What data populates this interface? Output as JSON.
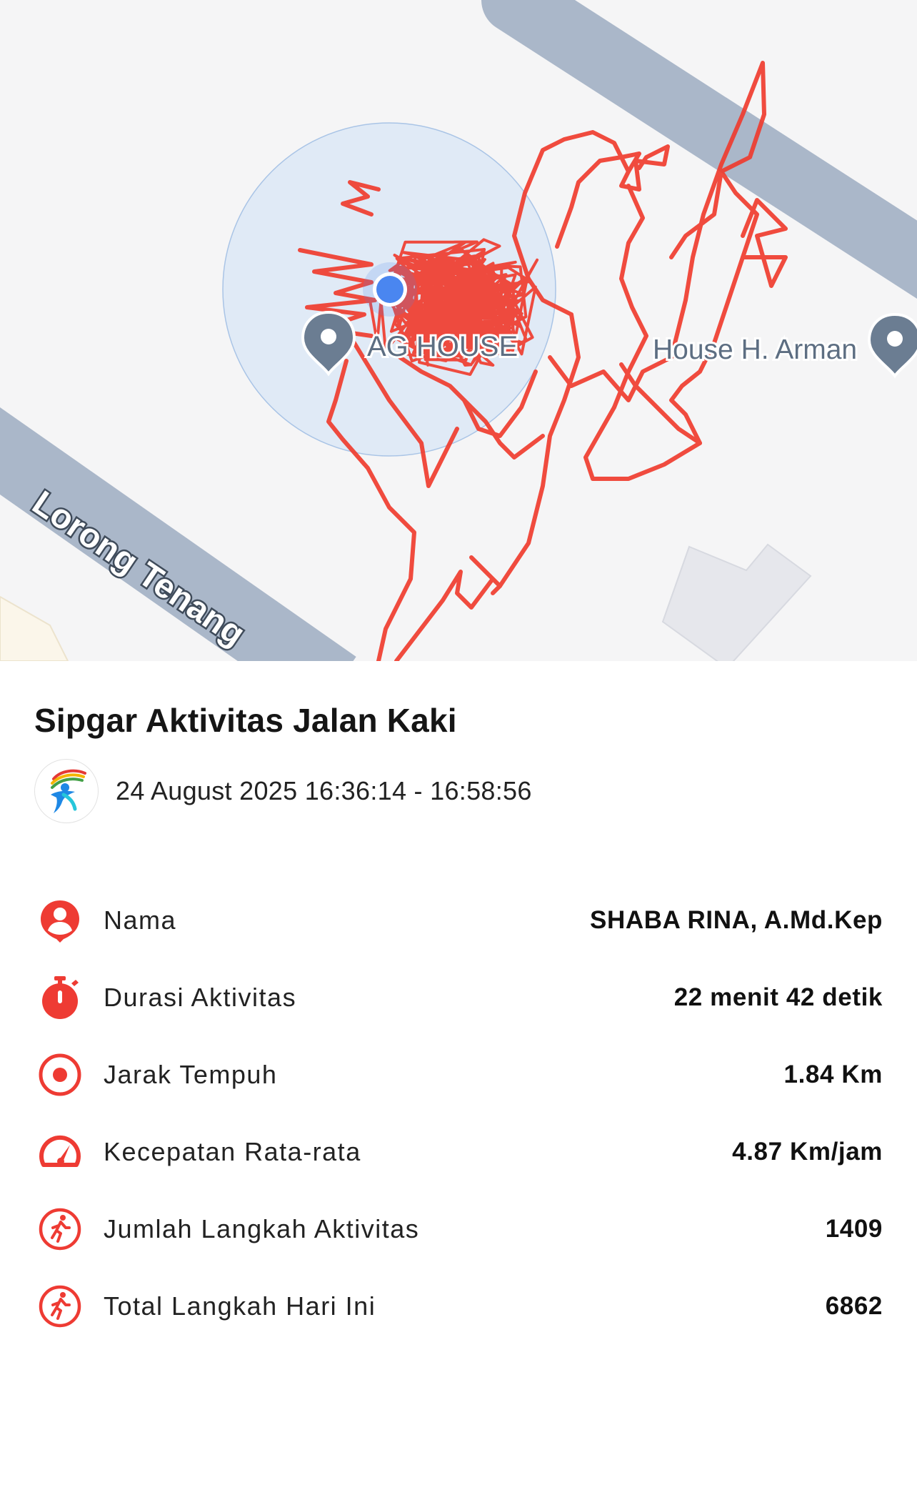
{
  "map": {
    "road_label": "Lorong Tenang",
    "places": [
      {
        "name": "AG HOUSE",
        "icon": "map-pin-icon"
      },
      {
        "name": "House H. Arman",
        "icon": "map-pin-icon"
      }
    ],
    "current_location_icon": "location-dot-icon",
    "route_color": "#f0392b"
  },
  "activity": {
    "title": "Sipgar Aktivitas Jalan Kaki",
    "app_logo_icon": "sipgar-runner-logo-icon",
    "date_range": "24 August 2025 16:36:14 - 16:58:56"
  },
  "stats": [
    {
      "icon": "user-pin-icon",
      "label": "Nama",
      "value": "SHABA RINA, A.Md.Kep"
    },
    {
      "icon": "stopwatch-icon",
      "label": "Durasi Aktivitas",
      "value": "22 menit 42 detik"
    },
    {
      "icon": "target-icon",
      "label": "Jarak Tempuh",
      "value": "1.84 Km"
    },
    {
      "icon": "speedometer-icon",
      "label": "Kecepatan Rata-rata",
      "value": "4.87 Km/jam"
    },
    {
      "icon": "runner-icon",
      "label": "Jumlah Langkah Aktivitas",
      "value": "1409"
    },
    {
      "icon": "runner-icon",
      "label": "Total Langkah Hari Ini",
      "value": "6862"
    }
  ],
  "colors": {
    "accent": "#ee3b33",
    "road": "#aab7c9",
    "map_background": "#f5f5f6",
    "accuracy_circle": "#dce8f6",
    "location_dot": "#4a86f0"
  }
}
